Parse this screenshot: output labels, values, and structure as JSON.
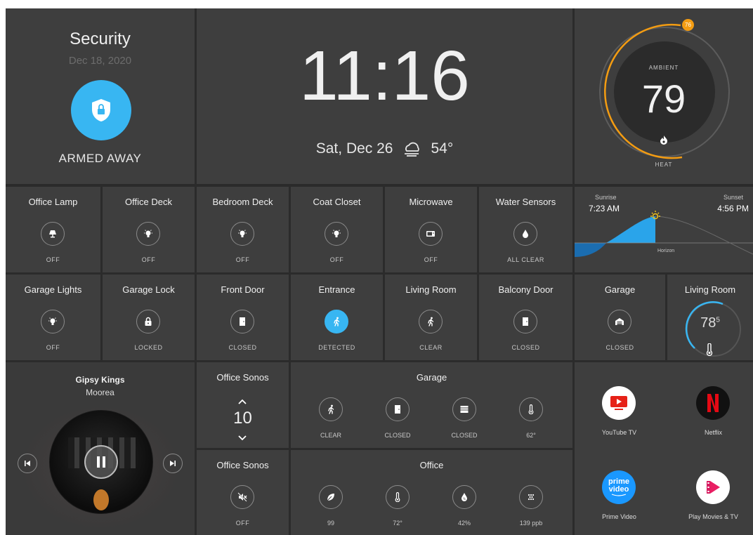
{
  "security": {
    "title": "Security",
    "date": "Dec 18, 2020",
    "status": "ARMED AWAY",
    "shield_color": "#38b6f2"
  },
  "clock": {
    "time": "11:16",
    "date": "Sat, Dec 26",
    "weather_icon": "cloudy-icon",
    "temp": "54°"
  },
  "thermostat": {
    "setpoint": "76",
    "label": "AMBIENT",
    "value": "79",
    "mode": "HEAT",
    "accent": "#f39c12"
  },
  "sun": {
    "sunrise_label": "Sunrise",
    "sunrise_time": "7:23 AM",
    "sunset_label": "Sunset",
    "sunset_time": "4:56 PM",
    "horizon_label": "Horizon"
  },
  "row1": [
    {
      "title": "Office Lamp",
      "state": "OFF",
      "icon": "lamp-icon"
    },
    {
      "title": "Office Deck",
      "state": "OFF",
      "icon": "bulb-icon"
    },
    {
      "title": "Bedroom Deck",
      "state": "OFF",
      "icon": "bulb-icon"
    },
    {
      "title": "Coat Closet",
      "state": "OFF",
      "icon": "bulb-icon"
    },
    {
      "title": "Microwave",
      "state": "OFF",
      "icon": "microwave-icon"
    },
    {
      "title": "Water Sensors",
      "state": "ALL CLEAR",
      "icon": "water-drop-icon"
    }
  ],
  "row2": [
    {
      "title": "Garage Lights",
      "state": "OFF",
      "icon": "bulb-icon"
    },
    {
      "title": "Garage Lock",
      "state": "LOCKED",
      "icon": "lock-icon"
    },
    {
      "title": "Front Door",
      "state": "CLOSED",
      "icon": "door-icon"
    },
    {
      "title": "Entrance",
      "state": "DETECTED",
      "icon": "motion-icon"
    },
    {
      "title": "Living Room",
      "state": "CLEAR",
      "icon": "motion-icon"
    },
    {
      "title": "Balcony Door",
      "state": "CLOSED",
      "icon": "door-icon"
    },
    {
      "title": "Garage",
      "state": "CLOSED",
      "icon": "garage-icon"
    }
  ],
  "living_temp": {
    "title": "Living Room",
    "value": "78",
    "decimal": "5"
  },
  "media": {
    "artist": "Gipsy Kings",
    "track": "Moorea"
  },
  "sonos_volume": {
    "title": "Office Sonos",
    "value": "10"
  },
  "sonos_mute": {
    "title": "Office Sonos",
    "state": "OFF"
  },
  "garage_group": {
    "title": "Garage",
    "items": [
      {
        "label": "CLEAR",
        "icon": "motion-icon"
      },
      {
        "label": "CLOSED",
        "icon": "door-icon"
      },
      {
        "label": "CLOSED",
        "icon": "garage-door-icon"
      },
      {
        "label": "62°",
        "icon": "thermometer-icon"
      }
    ]
  },
  "office_group": {
    "title": "Office",
    "items": [
      {
        "label": "99",
        "icon": "leaf-icon"
      },
      {
        "label": "72°",
        "icon": "thermometer-icon"
      },
      {
        "label": "42%",
        "icon": "humidity-icon"
      },
      {
        "label": "139 ppb",
        "icon": "air-quality-icon"
      }
    ]
  },
  "apps": [
    {
      "label": "YouTube TV",
      "icon": "youtube-tv-icon"
    },
    {
      "label": "Netflix",
      "icon": "netflix-icon"
    },
    {
      "label": "Prime Video",
      "icon": "prime-video-icon",
      "logo_line1": "prime",
      "logo_line2": "video"
    },
    {
      "label": "Play Movies & TV",
      "icon": "play-movies-icon"
    }
  ]
}
